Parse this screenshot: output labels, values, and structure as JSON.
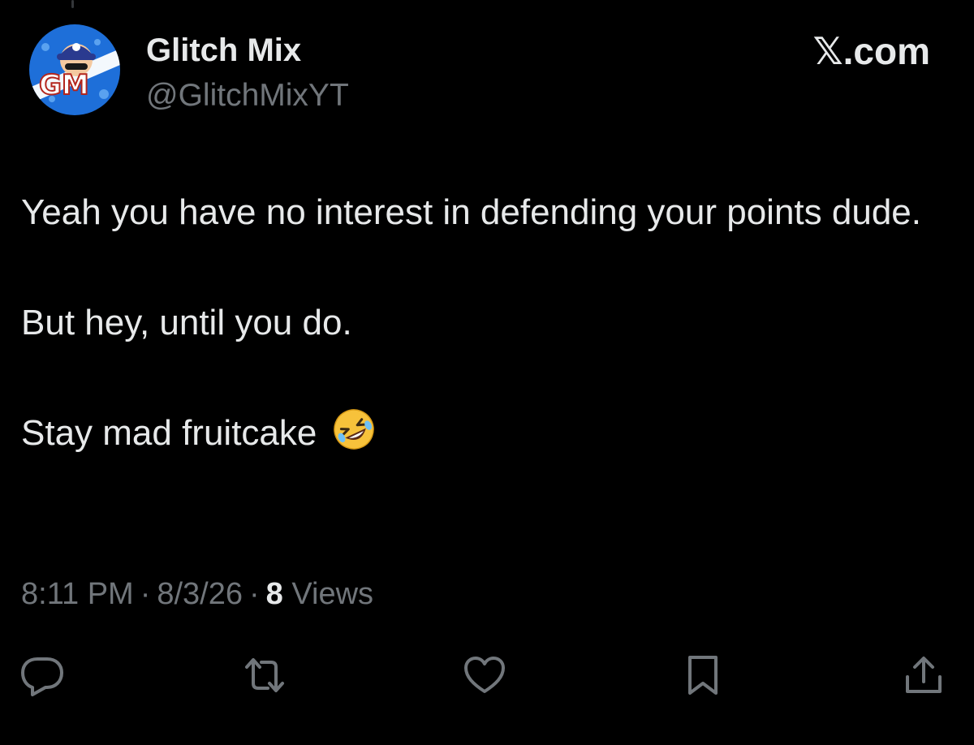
{
  "author": {
    "display_name": "Glitch Mix",
    "handle": "@GlitchMixYT",
    "avatar_initials": "GM"
  },
  "source": "𝕏.com",
  "tweet": {
    "paragraphs": [
      "Yeah you have no interest in defending your points dude.",
      "But hey, until you do.",
      "Stay mad fruitcake"
    ],
    "emoji": "rolling-on-the-floor-laughing"
  },
  "meta": {
    "time": "8:11 PM",
    "date": "8/3/26",
    "separator": "·",
    "views_count": "8",
    "views_label": "Views"
  },
  "actions": [
    {
      "name": "reply",
      "icon": "reply-icon"
    },
    {
      "name": "retweet",
      "icon": "retweet-icon"
    },
    {
      "name": "like",
      "icon": "heart-icon"
    },
    {
      "name": "bookmark",
      "icon": "bookmark-icon"
    },
    {
      "name": "share",
      "icon": "share-icon"
    }
  ],
  "colors": {
    "background": "#000000",
    "text_primary": "#e7e9ea",
    "text_secondary": "#71767b",
    "avatar_blue": "#1e6fd9"
  }
}
